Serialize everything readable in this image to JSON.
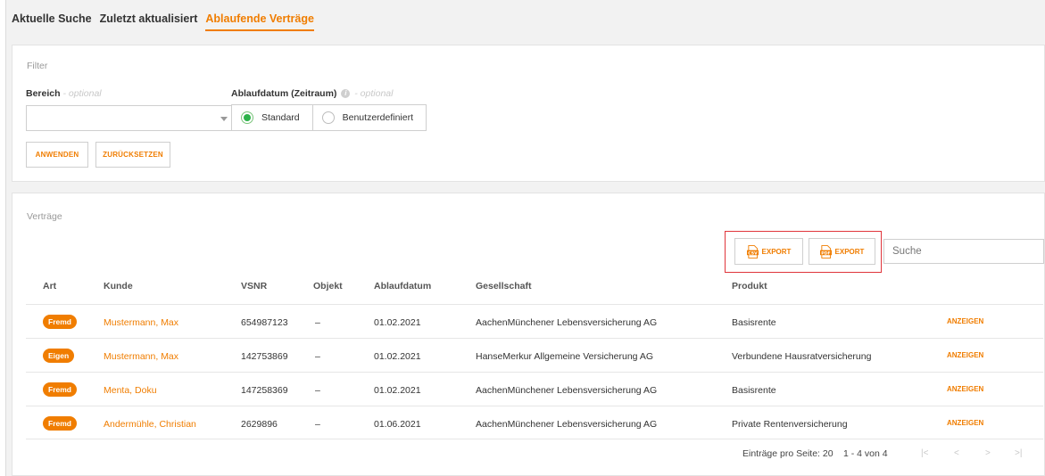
{
  "tabs": [
    {
      "label": "Aktuelle Suche",
      "active": false
    },
    {
      "label": "Zuletzt aktualisiert",
      "active": false
    },
    {
      "label": "Ablaufende Verträge",
      "active": true
    }
  ],
  "filter": {
    "title": "Filter",
    "bereich_label": "Bereich",
    "bereich_optional": " - optional",
    "bereich_value": "",
    "ablauf_label": "Ablaufdatum (Zeitraum)",
    "ablauf_optional": " - optional",
    "info_glyph": "i",
    "radio_options": [
      {
        "label": "Standard",
        "checked": true
      },
      {
        "label": "Benutzerdefiniert",
        "checked": false
      }
    ],
    "apply_label": "ANWENDEN",
    "reset_label": "ZURÜCKSETZEN"
  },
  "contracts": {
    "title": "Verträge",
    "export_csv_label": "EXPORT",
    "export_pdf_label": "EXPORT",
    "csv_icon_text": "CSV",
    "pdf_icon_text": "PDF",
    "search_placeholder": "Suche",
    "columns": [
      "Art",
      "Kunde",
      "VSNR",
      "Objekt",
      "Ablaufdatum",
      "Gesellschaft",
      "Produkt"
    ],
    "rows": [
      {
        "art": "Fremd",
        "kunde": "Mustermann, Max",
        "vsnr": "654987123",
        "objekt": "–",
        "ablaufdatum": "01.02.2021",
        "gesellschaft": "AachenMünchener Lebensversicherung AG",
        "produkt": "Basisrente",
        "action": "ANZEIGEN"
      },
      {
        "art": "Eigen",
        "kunde": "Mustermann, Max",
        "vsnr": "142753869",
        "objekt": "–",
        "ablaufdatum": "01.02.2021",
        "gesellschaft": "HanseMerkur Allgemeine Versicherung AG",
        "produkt": "Verbundene Hausratversicherung",
        "action": "ANZEIGEN"
      },
      {
        "art": "Fremd",
        "kunde": "Menta, Doku",
        "vsnr": "147258369",
        "objekt": "–",
        "ablaufdatum": "01.02.2021",
        "gesellschaft": "AachenMünchener Lebensversicherung AG",
        "produkt": "Basisrente",
        "action": "ANZEIGEN"
      },
      {
        "art": "Fremd",
        "kunde": "Andermühle, Christian",
        "vsnr": "2629896",
        "objekt": "–",
        "ablaufdatum": "01.06.2021",
        "gesellschaft": "AachenMünchener Lebensversicherung AG",
        "produkt": "Private Rentenversicherung",
        "action": "ANZEIGEN"
      }
    ],
    "pagination": {
      "per_page_text": "Einträge pro Seite: 20",
      "range_text": "1 - 4 von 4",
      "first_glyph": "|<",
      "prev_glyph": "<",
      "next_glyph": ">",
      "last_glyph": ">|"
    }
  },
  "colors": {
    "accent": "#f07d00",
    "radio_checked": "#2db34a",
    "highlight_border": "#e0353b"
  }
}
